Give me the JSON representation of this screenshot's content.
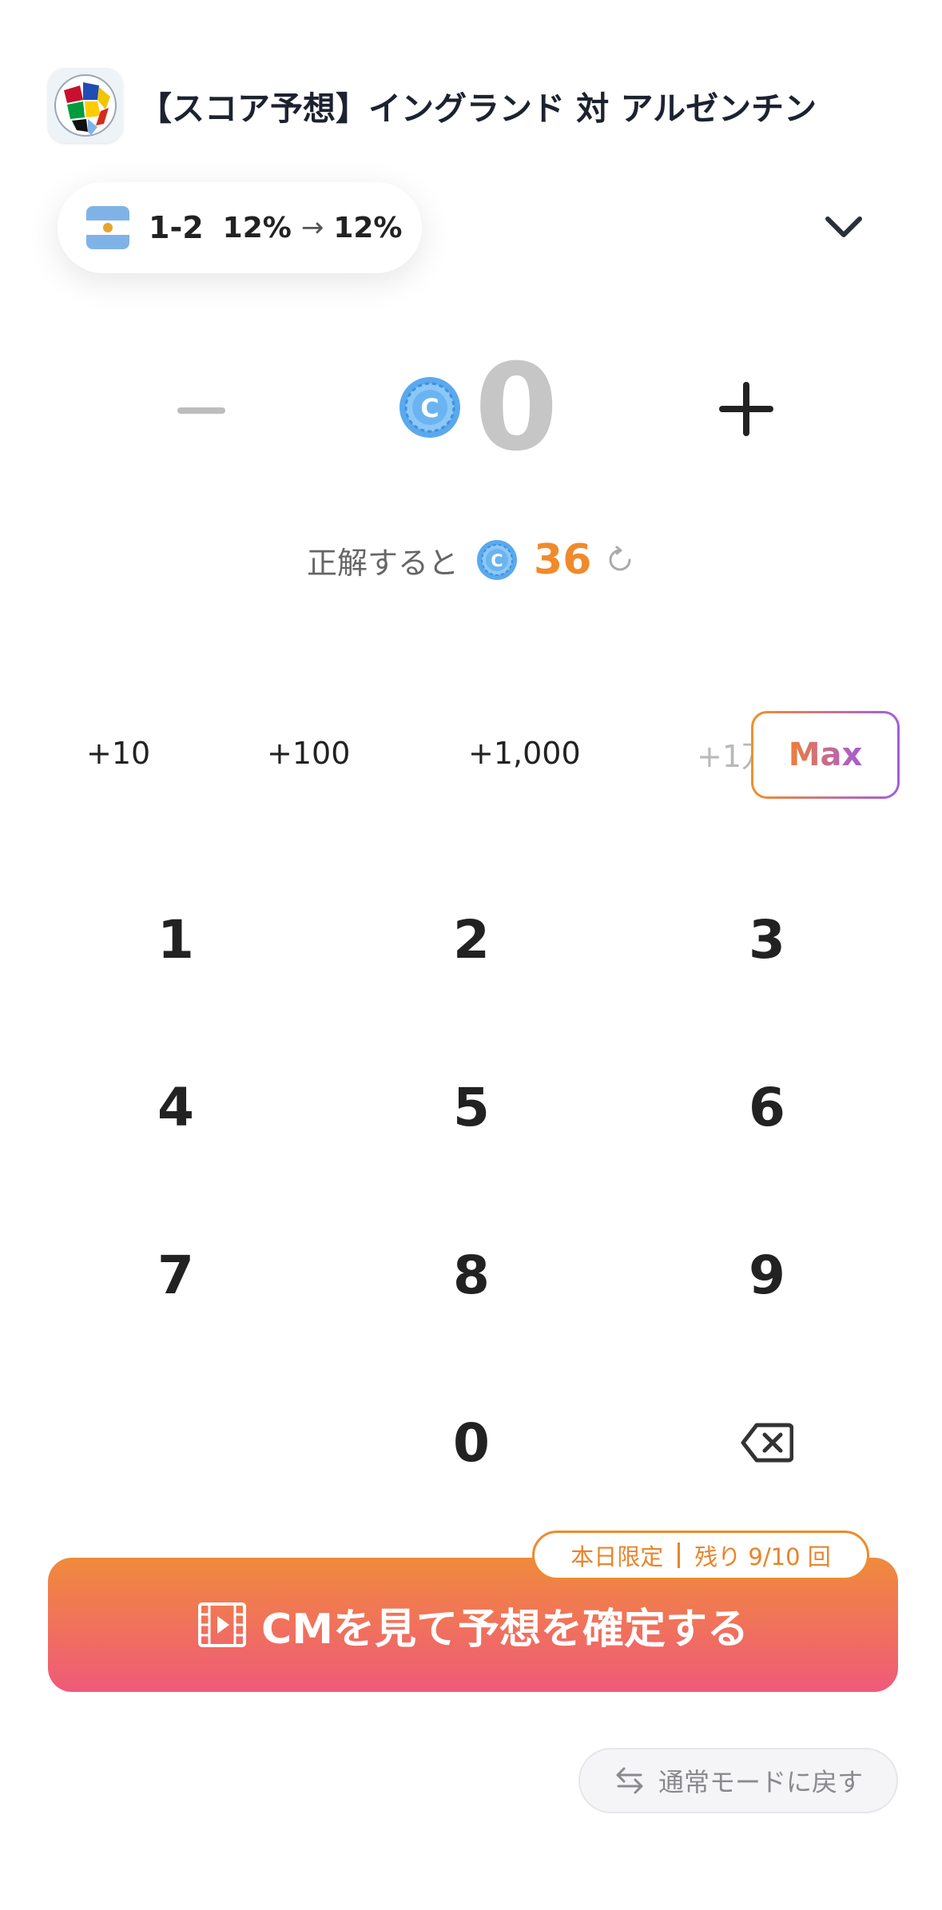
{
  "header": {
    "title": "【スコア予想】イングランド 対 アルゼンチン",
    "app_icon": "soccer-ball-flags-icon"
  },
  "prediction": {
    "flag": "argentina",
    "score": "1-2",
    "pct_from": "12%",
    "pct_to": "12%",
    "arrow": "→"
  },
  "amount": {
    "value": "0",
    "coin_icon": "coin-icon",
    "minus": "minus-icon",
    "plus": "plus-icon"
  },
  "reward": {
    "label": "正解すると",
    "value": "36"
  },
  "quick_add": [
    "+10",
    "+100",
    "+1,000",
    "+1万"
  ],
  "max_label": "Max",
  "keypad": [
    "1",
    "2",
    "3",
    "4",
    "5",
    "6",
    "7",
    "8",
    "9",
    "0"
  ],
  "cta": {
    "label": "CMを見て予想を確定する",
    "badge_left": "本日限定",
    "badge_right": "残り 9/10 回"
  },
  "normal_mode_label": "通常モードに戻す",
  "colors": {
    "accent_orange": "#f08a2b",
    "cta_top": "#f08a3c",
    "cta_bottom": "#ef5a7a",
    "max_gradient_end": "#a35ce0",
    "coin_blue": "#5aa9ee"
  }
}
